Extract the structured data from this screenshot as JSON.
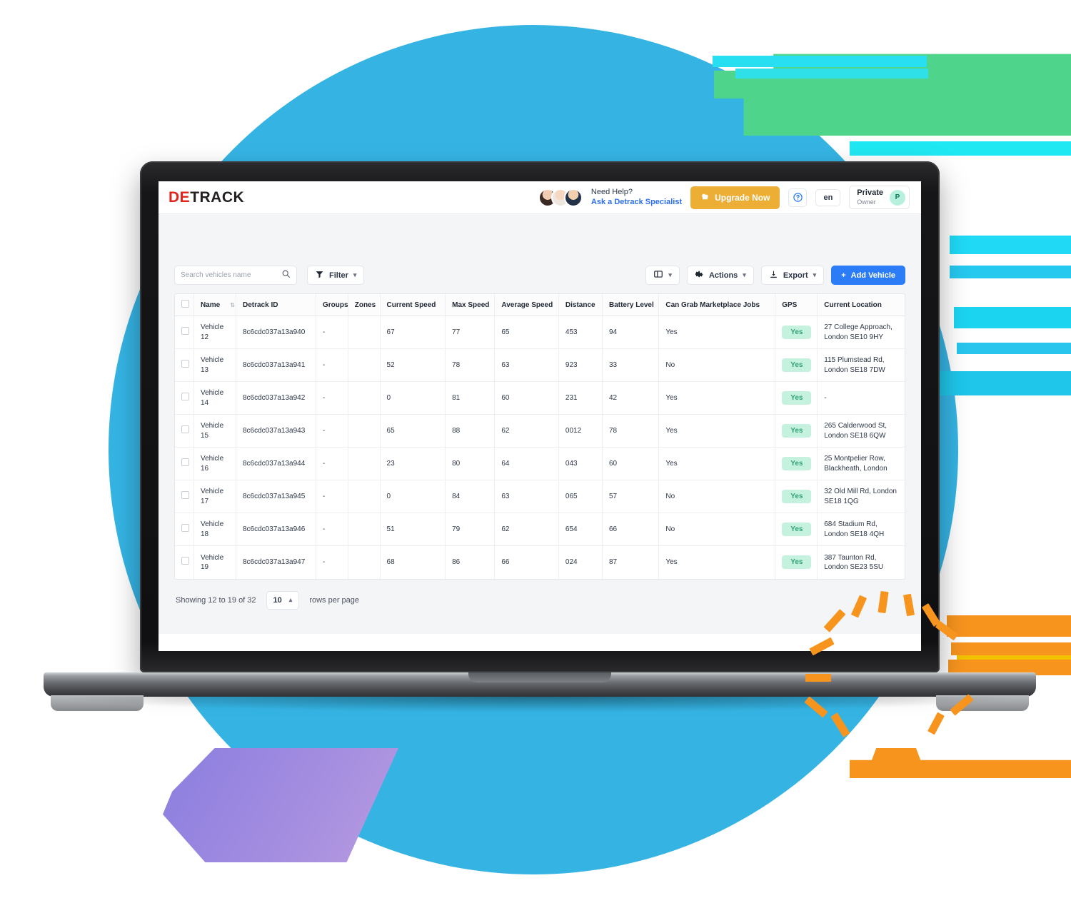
{
  "brand": {
    "logo_left": "DE",
    "logo_right": "TRACK"
  },
  "header": {
    "help_line1": "Need Help?",
    "help_line2": "Ask a Detrack Specialist",
    "upgrade_label": "Upgrade Now",
    "help_icon": "question-circle-icon",
    "language": "en",
    "user_name": "Private",
    "user_role": "Owner",
    "user_initial": "P",
    "upgrade_color": "#ecae34",
    "link_color": "#2b6ef5"
  },
  "toolbar": {
    "search_placeholder": "Search vehicles name",
    "search_value": "",
    "filter_label": "Filter",
    "columns_label": "",
    "actions_label": "Actions",
    "export_label": "Export",
    "add_vehicle_label": "Add Vehicle",
    "add_vehicle_plus": "+",
    "primary_color": "#2b7cf6"
  },
  "table": {
    "columns": [
      "Name",
      "Detrack ID",
      "Groups",
      "Zones",
      "Current Speed",
      "Max Speed",
      "Average Speed",
      "Distance",
      "Battery Level",
      "Can Grab Marketplace Jobs",
      "GPS",
      "Current Location"
    ],
    "rows": [
      {
        "name": "Vehicle 12",
        "detrack_id": "8c6cdc037a13a940",
        "groups": "-",
        "zones": "",
        "current_speed": "67",
        "max_speed": "77",
        "average_speed": "65",
        "distance": "453",
        "battery_level": "94",
        "can_grab": "Yes",
        "gps": "Yes",
        "location": "27 College Approach, London SE10 9HY"
      },
      {
        "name": "Vehicle 13",
        "detrack_id": "8c6cdc037a13a941",
        "groups": "-",
        "zones": "",
        "current_speed": "52",
        "max_speed": "78",
        "average_speed": "63",
        "distance": "923",
        "battery_level": "33",
        "can_grab": "No",
        "gps": "Yes",
        "location": "115 Plumstead Rd, London SE18 7DW"
      },
      {
        "name": "Vehicle 14",
        "detrack_id": "8c6cdc037a13a942",
        "groups": "-",
        "zones": "",
        "current_speed": "0",
        "max_speed": "81",
        "average_speed": "60",
        "distance": "231",
        "battery_level": "42",
        "can_grab": "Yes",
        "gps": "Yes",
        "location": "-"
      },
      {
        "name": "Vehicle 15",
        "detrack_id": "8c6cdc037a13a943",
        "groups": "-",
        "zones": "",
        "current_speed": "65",
        "max_speed": "88",
        "average_speed": "62",
        "distance": "0012",
        "battery_level": "78",
        "can_grab": "Yes",
        "gps": "Yes",
        "location": "265 Calderwood St, London SE18 6QW"
      },
      {
        "name": "Vehicle 16",
        "detrack_id": "8c6cdc037a13a944",
        "groups": "-",
        "zones": "",
        "current_speed": "23",
        "max_speed": "80",
        "average_speed": "64",
        "distance": "043",
        "battery_level": "60",
        "can_grab": "Yes",
        "gps": "Yes",
        "location": "25 Montpelier Row, Blackheath, London"
      },
      {
        "name": "Vehicle 17",
        "detrack_id": "8c6cdc037a13a945",
        "groups": "-",
        "zones": "",
        "current_speed": "0",
        "max_speed": "84",
        "average_speed": "63",
        "distance": "065",
        "battery_level": "57",
        "can_grab": "No",
        "gps": "Yes",
        "location": "32 Old Mill Rd, London SE18 1QG"
      },
      {
        "name": "Vehicle 18",
        "detrack_id": "8c6cdc037a13a946",
        "groups": "-",
        "zones": "",
        "current_speed": "51",
        "max_speed": "79",
        "average_speed": "62",
        "distance": "654",
        "battery_level": "66",
        "can_grab": "No",
        "gps": "Yes",
        "location": "684 Stadium Rd, London SE18 4QH"
      },
      {
        "name": "Vehicle 19",
        "detrack_id": "8c6cdc037a13a947",
        "groups": "-",
        "zones": "",
        "current_speed": "68",
        "max_speed": "86",
        "average_speed": "66",
        "distance": "024",
        "battery_level": "87",
        "can_grab": "Yes",
        "gps": "Yes",
        "location": "387 Taunton Rd, London SE23 5SU"
      }
    ],
    "badge_color": "#c4f2de",
    "badge_text_color": "#34a17c"
  },
  "footer": {
    "showing_text": "Showing 12 to 19 of 32",
    "rows_per_page_value": "10",
    "rows_per_page_label": "rows per page"
  },
  "decor": {
    "blue": "#35b4e4",
    "green": "#4ed48b",
    "purple": "#a58ee0",
    "orange": "#f7941e",
    "cyan": "#27dff0"
  }
}
